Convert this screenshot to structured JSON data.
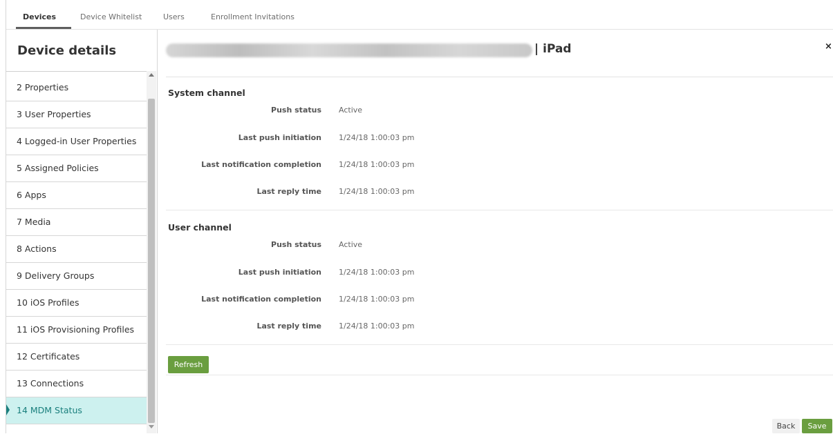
{
  "tabs": [
    {
      "label": "Devices",
      "active": true
    },
    {
      "label": "Device Whitelist",
      "active": false
    },
    {
      "label": "Users",
      "active": false
    },
    {
      "label": "Enrollment Invitations",
      "active": false
    }
  ],
  "sidebar": {
    "title": "Device details",
    "items": [
      {
        "label": "2  Properties"
      },
      {
        "label": "3  User Properties"
      },
      {
        "label": "4  Logged-in User Properties"
      },
      {
        "label": "5  Assigned Policies"
      },
      {
        "label": "6  Apps"
      },
      {
        "label": "7  Media"
      },
      {
        "label": "8  Actions"
      },
      {
        "label": "9  Delivery Groups"
      },
      {
        "label": "10  iOS Profiles"
      },
      {
        "label": "11  iOS Provisioning Profiles"
      },
      {
        "label": "12  Certificates"
      },
      {
        "label": "13  Connections"
      },
      {
        "label": "14  MDM Status",
        "active": true
      }
    ]
  },
  "header": {
    "device_type": "| iPad",
    "close_icon": "×"
  },
  "system_channel": {
    "title": "System channel",
    "rows": [
      {
        "label": "Push status",
        "value": "Active"
      },
      {
        "label": "Last push initiation",
        "value": "1/24/18 1:00:03 pm"
      },
      {
        "label": "Last notification completion",
        "value": "1/24/18 1:00:03 pm"
      },
      {
        "label": "Last reply time",
        "value": "1/24/18 1:00:03 pm"
      }
    ]
  },
  "user_channel": {
    "title": "User channel",
    "rows": [
      {
        "label": "Push status",
        "value": "Active"
      },
      {
        "label": "Last push initiation",
        "value": "1/24/18 1:00:03 pm"
      },
      {
        "label": "Last notification completion",
        "value": "1/24/18 1:00:03 pm"
      },
      {
        "label": "Last reply time",
        "value": "1/24/18 1:00:03 pm"
      }
    ]
  },
  "buttons": {
    "refresh": "Refresh",
    "back": "Back",
    "save": "Save"
  },
  "colors": {
    "accent_green": "#6a9e3f",
    "active_item_bg": "#cdf1ef",
    "active_item_text": "#1a7f7d"
  }
}
